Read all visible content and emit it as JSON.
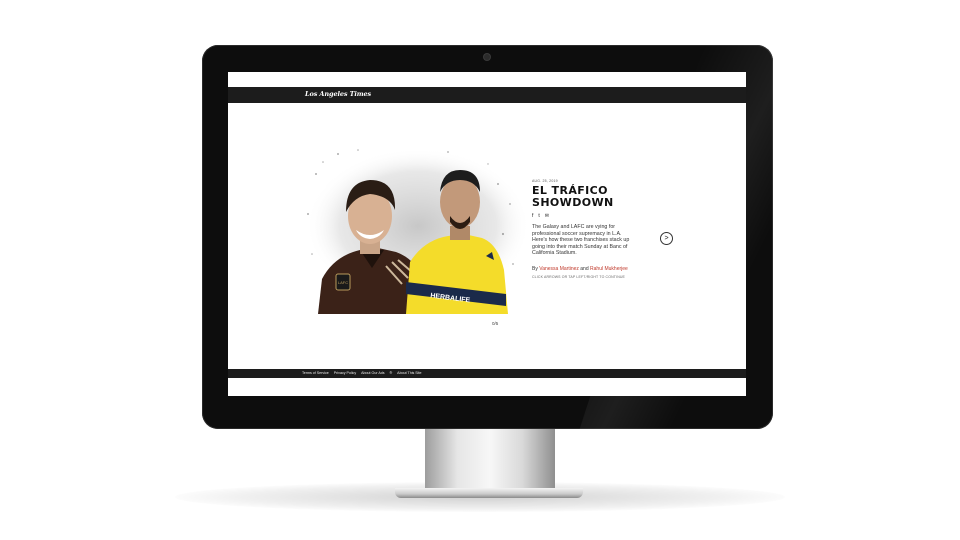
{
  "site": {
    "logo_text": "Los Angeles Times"
  },
  "story": {
    "date": "AUG. 25, 2019",
    "headline_line1": "EL TRÁFICO",
    "headline_line2": "SHOWDOWN",
    "share": {
      "facebook_icon": "f",
      "twitter_icon": "t",
      "email_icon": "✉"
    },
    "dek": "The Galaxy and LAFC are vying for professional soccer supremacy in L.A. Here's how these two franchises stack up going into their match Sunday at Banc of California Stadium.",
    "byline": {
      "prefix": "By",
      "author1": "Vanessa Martinez",
      "joiner": "and",
      "author2": "Rahul Mukherjee"
    },
    "hint": "CLICK ARROWS OR TAP LEFT/RIGHT TO CONTINUE",
    "next_arrow": ">",
    "counter": "0/5",
    "image_text": {
      "lafc_badge": "LAFC",
      "galaxy_sponsor": "HERBALIFE"
    }
  },
  "footer": {
    "links": [
      "Terms of Service",
      "Privacy Policy",
      "About Our Ads",
      "®",
      "About This Site"
    ]
  },
  "colors": {
    "accent_link": "#c0392b",
    "bar": "#1c1c1c",
    "bezel": "#0d0d0d"
  }
}
